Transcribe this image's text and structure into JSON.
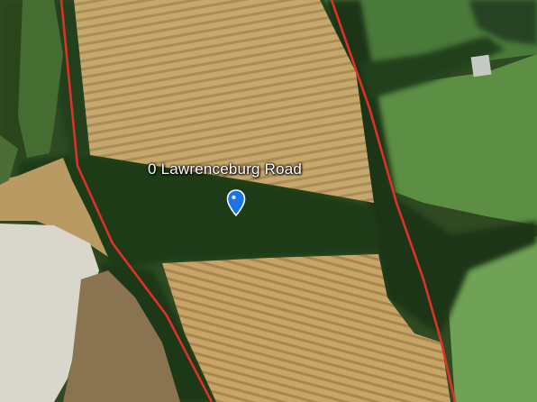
{
  "map": {
    "view": "satellite",
    "place_label": "0 Lawrenceburg Road",
    "marker_icon": "location-pin-icon",
    "marker_color": "#1a73e8",
    "boundary_color": "#e0302a"
  }
}
